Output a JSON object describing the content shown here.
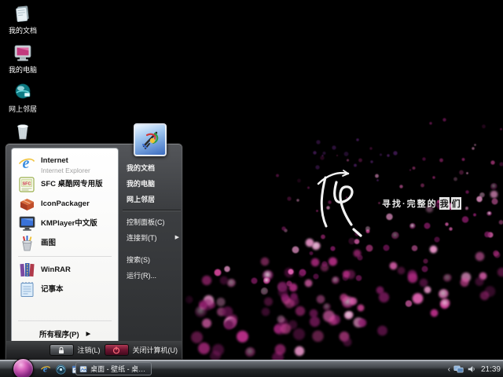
{
  "desktop": {
    "icons": [
      {
        "label": "我的文档"
      },
      {
        "label": "我的电脑"
      },
      {
        "label": "网上邻居"
      },
      {
        "label": "回收站"
      }
    ],
    "wallpaper": {
      "tagline": "寻找·完整的",
      "tagline_box1": "我",
      "tagline_box2": "们",
      "accent_color": "#c2318f"
    }
  },
  "start_menu": {
    "submenu_arrow": "▶",
    "left_items": [
      {
        "title": "Internet",
        "subtitle": "Internet Explorer"
      },
      {
        "title": "SFC 桌酷网专用版"
      },
      {
        "title": "IconPackager"
      },
      {
        "title": "KMPlayer中文版"
      },
      {
        "title": "画图"
      },
      {
        "title": "WinRAR"
      },
      {
        "title": "记事本"
      }
    ],
    "all_programs_label": "所有程序(P)",
    "right_items_top": [
      "我的文档",
      "我的电脑",
      "网上邻居"
    ],
    "right_items_bottom": [
      "控制面板(C)",
      "连接到(T)",
      "搜索(S)",
      "运行(R)..."
    ],
    "logoff_label": "注销(L)",
    "shutdown_label": "关闭计算机(U)"
  },
  "taskbar": {
    "quick_launch_overflow": "»",
    "task_button_label": "桌面 - 壁纸 - 桌酷壁...",
    "tray_collapse": "‹",
    "clock": "21:39"
  }
}
